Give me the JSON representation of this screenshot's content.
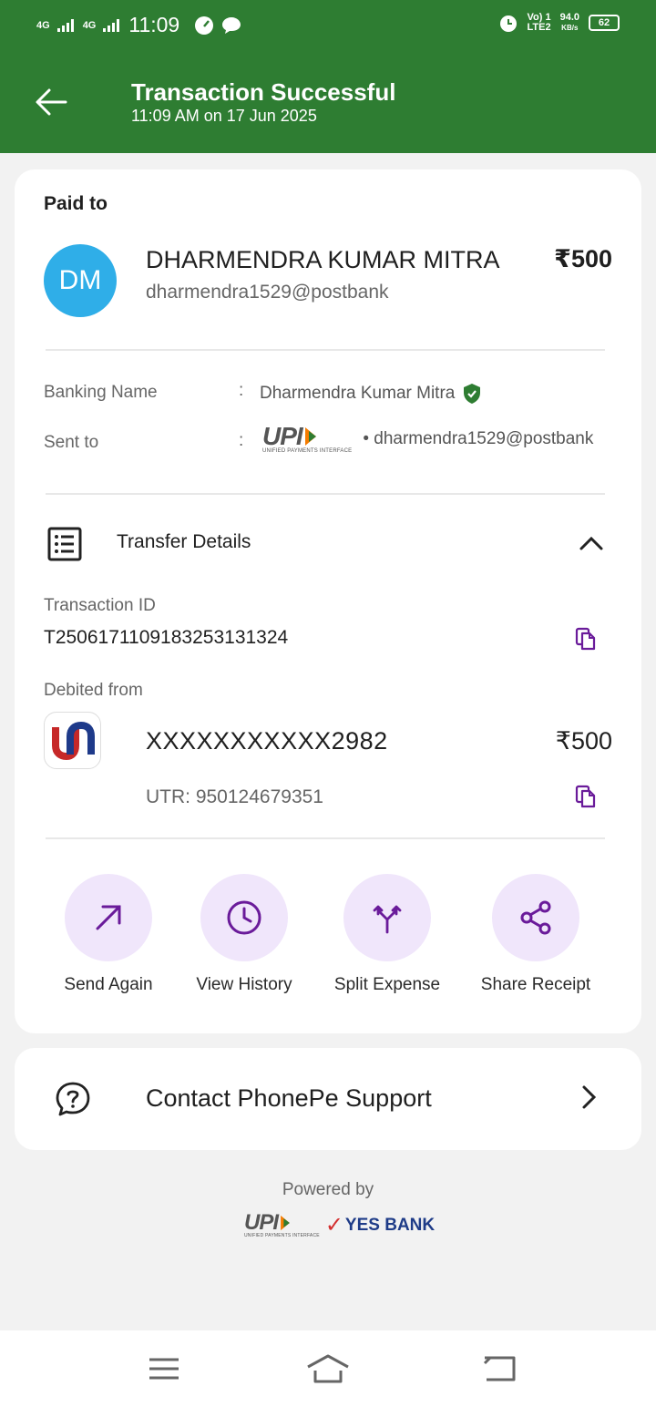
{
  "status_bar": {
    "signal1": "4G",
    "signal2": "4G",
    "time": "11:09",
    "vol": "Vo) 1",
    "lte": "LTE2",
    "speed": "94.0",
    "speed_unit": "KB/s",
    "battery": "62"
  },
  "header": {
    "title": "Transaction Successful",
    "subtitle": "11:09 AM on 17 Jun 2025",
    "bg_color": "#2e7d32"
  },
  "payment": {
    "paid_to_label": "Paid to",
    "avatar_initials": "DM",
    "payee_name": "DHARMENDRA KUMAR MITRA",
    "payee_upi": "dharmendra1529@postbank",
    "amount": "₹500"
  },
  "details": {
    "banking_name_label": "Banking Name",
    "banking_name": "Dharmendra Kumar Mitra",
    "sent_to_label": "Sent to",
    "upi_logo_text": "UPI",
    "upi_logo_small": "UNIFIED PAYMENTS INTERFACE",
    "sent_to_value": "• dharmendra1529@postbank",
    "colon": ":"
  },
  "transfer": {
    "section_label": "Transfer Details",
    "txid_label": "Transaction ID",
    "txid": "T2506171109183253131324",
    "debited_label": "Debited from",
    "account": "XXXXXXXXXXX2982",
    "account_amount": "₹500",
    "utr": "UTR: 950124679351"
  },
  "actions": [
    {
      "label": "Send Again",
      "icon": "arrow-up-right-icon"
    },
    {
      "label": "View History",
      "icon": "clock-icon"
    },
    {
      "label": "Split Expense",
      "icon": "split-icon"
    },
    {
      "label": "Share Receipt",
      "icon": "share-icon"
    }
  ],
  "support": {
    "label": "Contact PhonePe Support"
  },
  "footer": {
    "powered_by": "Powered by",
    "upi_text": "UPI",
    "bank_text": "YES BANK"
  },
  "colors": {
    "accent_purple": "#6a1b9a",
    "action_bg": "#f0e6fb",
    "verified_green": "#2e7d32",
    "avatar_blue": "#2faee8"
  }
}
